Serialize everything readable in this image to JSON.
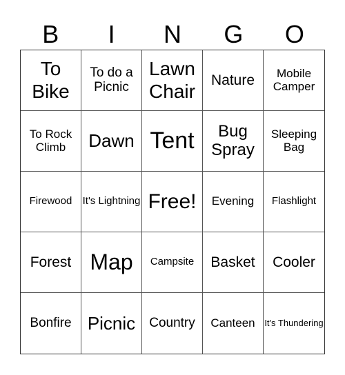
{
  "header": {
    "letters": [
      "B",
      "I",
      "N",
      "G",
      "O"
    ]
  },
  "grid": {
    "rows": [
      [
        "To Bike",
        "To do a Picnic",
        "Lawn Chair",
        "Nature",
        "Mobile Camper"
      ],
      [
        "To Rock Climb",
        "Dawn",
        "Tent",
        "Bug Spray",
        "Sleeping Bag"
      ],
      [
        "Firewood",
        "It's Lightning",
        "Free!",
        "Evening",
        "Flashlight"
      ],
      [
        "Forest",
        "Map",
        "Campsite",
        "Basket",
        "Cooler"
      ],
      [
        "Bonfire",
        "Picnic",
        "Country",
        "Canteen",
        "It's Thundering"
      ]
    ]
  }
}
